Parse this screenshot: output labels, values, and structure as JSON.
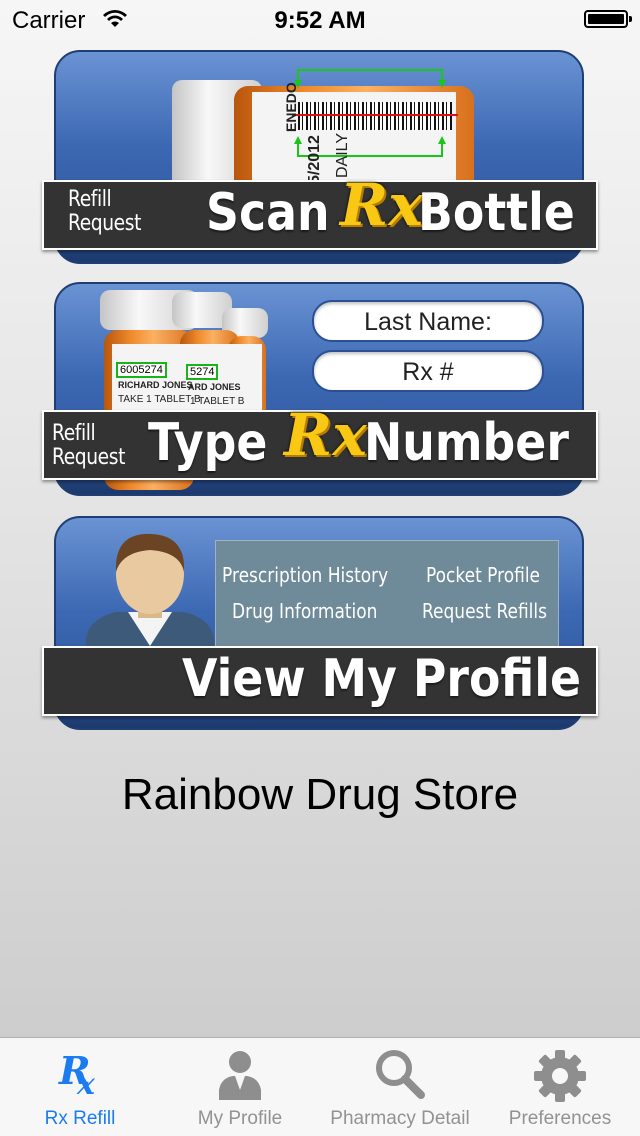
{
  "status_bar": {
    "carrier": "Carrier",
    "time": "9:52 AM"
  },
  "scan_card": {
    "small_label": "Refill\nRequest",
    "word_left": "Scan",
    "rx_logo": "Rx",
    "word_right": "Bottle",
    "bottle_label_lines": [
      "ENEDO",
      "5/2012",
      "DAILY"
    ]
  },
  "type_card": {
    "small_label": "Refill\nRequest",
    "word_left": "Type",
    "rx_logo": "Rx",
    "word_right": "Number",
    "last_name_field": "Last Name:",
    "rx_number_field": "Rx #",
    "bottle_text": {
      "number_1": "6005274",
      "number_2": "5274",
      "name": "RICHARD JONES",
      "name_2": "ARD JONES",
      "instructions": "TAKE 1 TABLET B",
      "instructions_2": "1 TABLET B"
    }
  },
  "profile_card": {
    "title": "View My Profile",
    "menu": [
      "Prescription History",
      "Pocket Profile",
      "Drug Information",
      "Request Refills"
    ]
  },
  "store_name": "Rainbow Drug Store",
  "tabs": [
    {
      "label": "Rx Refill",
      "icon": "rx-icon",
      "active": true
    },
    {
      "label": "My Profile",
      "icon": "person-icon",
      "active": false
    },
    {
      "label": "Pharmacy Detail",
      "icon": "magnifier-icon",
      "active": false
    },
    {
      "label": "Preferences",
      "icon": "gear-icon",
      "active": false
    }
  ],
  "colors": {
    "accent": "#1b7cf2",
    "card_blue": "#3c68b3",
    "rx_yellow": "#f8c814",
    "inactive_tab": "#929292"
  }
}
